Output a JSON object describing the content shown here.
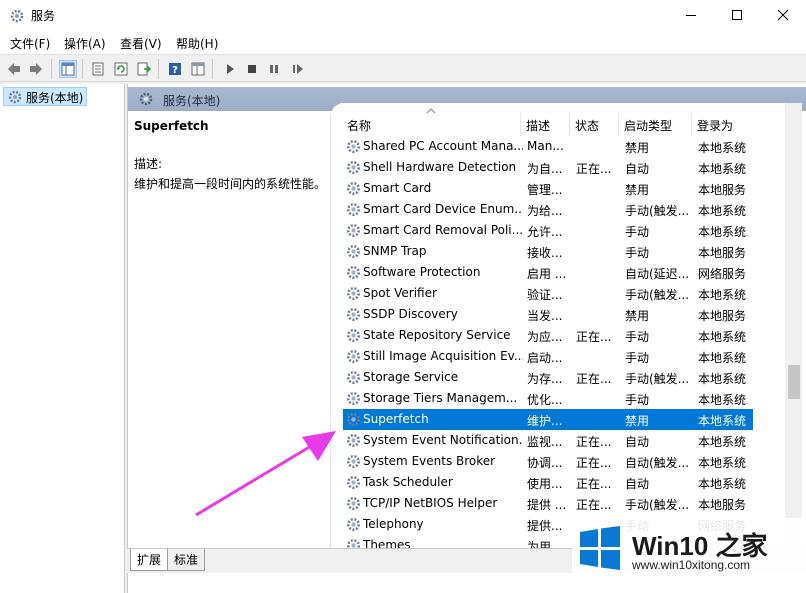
{
  "window": {
    "title": "服务"
  },
  "menu": [
    "文件(F)",
    "操作(A)",
    "查看(V)",
    "帮助(H)"
  ],
  "tree": {
    "item": "服务(本地)"
  },
  "content_header": "服务(本地)",
  "detail": {
    "service_name": "Superfetch",
    "desc_label": "描述:",
    "desc_text": "维护和提高一段时间内的系统性能。"
  },
  "columns": [
    "名称",
    "描述",
    "状态",
    "启动类型",
    "登录为"
  ],
  "rows": [
    {
      "name": "Shared PC Account Mana...",
      "desc": "Man...",
      "status": "",
      "start": "禁用",
      "logon": "本地系统"
    },
    {
      "name": "Shell Hardware Detection",
      "desc": "为自...",
      "status": "正在...",
      "start": "自动",
      "logon": "本地系统"
    },
    {
      "name": "Smart Card",
      "desc": "管理...",
      "status": "",
      "start": "禁用",
      "logon": "本地服务"
    },
    {
      "name": "Smart Card Device Enum...",
      "desc": "为给...",
      "status": "",
      "start": "手动(触发...",
      "logon": "本地系统"
    },
    {
      "name": "Smart Card Removal Poli...",
      "desc": "允许...",
      "status": "",
      "start": "手动",
      "logon": "本地系统"
    },
    {
      "name": "SNMP Trap",
      "desc": "接收...",
      "status": "",
      "start": "手动",
      "logon": "本地服务"
    },
    {
      "name": "Software Protection",
      "desc": "启用 ...",
      "status": "",
      "start": "自动(延迟...",
      "logon": "网络服务"
    },
    {
      "name": "Spot Verifier",
      "desc": "验证...",
      "status": "",
      "start": "手动(触发...",
      "logon": "本地系统"
    },
    {
      "name": "SSDP Discovery",
      "desc": "当发...",
      "status": "",
      "start": "禁用",
      "logon": "本地服务"
    },
    {
      "name": "State Repository Service",
      "desc": "为应...",
      "status": "正在...",
      "start": "手动",
      "logon": "本地系统"
    },
    {
      "name": "Still Image Acquisition Ev...",
      "desc": "启动...",
      "status": "",
      "start": "手动",
      "logon": "本地系统"
    },
    {
      "name": "Storage Service",
      "desc": "为存...",
      "status": "正在...",
      "start": "手动(触发...",
      "logon": "本地系统"
    },
    {
      "name": "Storage Tiers Managem...",
      "desc": "优化...",
      "status": "",
      "start": "手动",
      "logon": "本地系统"
    },
    {
      "name": "Superfetch",
      "desc": "维护...",
      "status": "",
      "start": "禁用",
      "logon": "本地系统",
      "selected": true
    },
    {
      "name": "System Event Notification...",
      "desc": "监视...",
      "status": "正在...",
      "start": "自动",
      "logon": "本地系统"
    },
    {
      "name": "System Events Broker",
      "desc": "协调...",
      "status": "正在...",
      "start": "自动(触发...",
      "logon": "本地系统"
    },
    {
      "name": "Task Scheduler",
      "desc": "使用...",
      "status": "正在...",
      "start": "自动",
      "logon": "本地系统"
    },
    {
      "name": "TCP/IP NetBIOS Helper",
      "desc": "提供 ...",
      "status": "正在...",
      "start": "手动(触发...",
      "logon": "本地服务"
    },
    {
      "name": "Telephony",
      "desc": "提供...",
      "status": "",
      "start": "手动",
      "logon": "网络服务"
    },
    {
      "name": "Themes",
      "desc": "为用...",
      "status": "",
      "start": "",
      "logon": ""
    }
  ],
  "tabs": [
    "扩展",
    "标准"
  ],
  "watermark": {
    "brand": "Win10 之家",
    "url": "www.win10xitong.com"
  },
  "colors": {
    "selection": "#0078d7",
    "arrow": "#e83be8",
    "logo_blue": "#0a78d4"
  },
  "icons": [
    "gear-icon",
    "back-arrow-icon",
    "forward-arrow-icon",
    "play-icon",
    "stop-icon",
    "pause-icon",
    "restart-icon",
    "help-icon"
  ]
}
